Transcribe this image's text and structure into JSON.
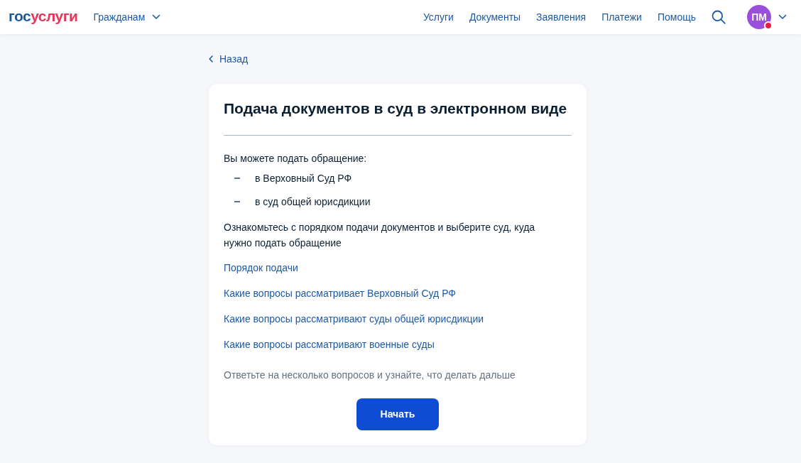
{
  "header": {
    "logo": [
      {
        "text": "гос",
        "color": "#1b5aa3"
      },
      {
        "text": "услуги",
        "color": "#e2395a"
      }
    ],
    "audience_menu": {
      "label": "Гражданам"
    },
    "nav": [
      "Услуги",
      "Документы",
      "Заявления",
      "Платежи",
      "Помощь"
    ],
    "avatar": {
      "initials": "ПМ",
      "has_notification": true
    }
  },
  "back_link": "Назад",
  "card": {
    "title": "Подача документов в суд в электронном виде",
    "intro": "Вы можете подать обращение:",
    "options": [
      "в Верховный Суд РФ",
      "в суд общей юрисдикции"
    ],
    "instructions": "Ознакомьтесь с порядком подачи документов и выберите суд, куда нужно подать обращение",
    "links": [
      "Порядок подачи",
      "Какие вопросы рассматривает Верховный Суд РФ",
      "Какие вопросы рассматривают суды общей юрисдикции",
      "Какие вопросы рассматривают военные суды"
    ],
    "hint": "Ответьте на несколько вопросов и узнайте, что делать дальше",
    "button": "Начать"
  }
}
